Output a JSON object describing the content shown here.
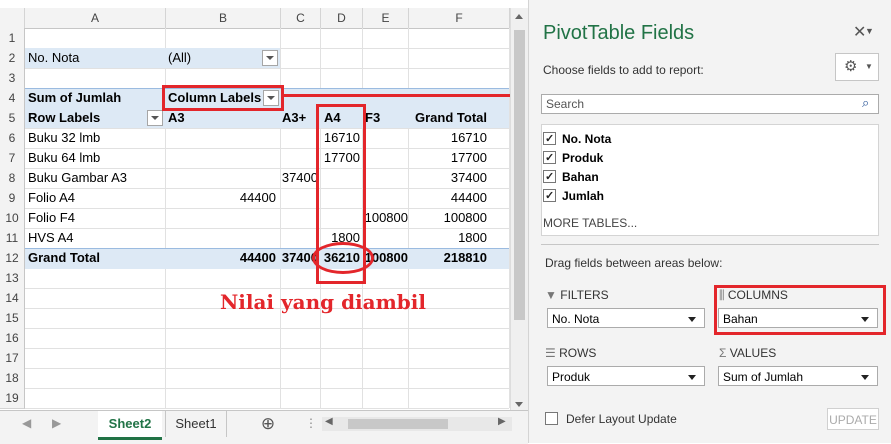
{
  "sheet": {
    "columns": [
      "A",
      "B",
      "C",
      "D",
      "E",
      "F"
    ],
    "rows": [
      "1",
      "2",
      "3",
      "4",
      "5",
      "6",
      "7",
      "8",
      "9",
      "10",
      "11",
      "12",
      "13",
      "14",
      "15",
      "16",
      "17",
      "18",
      "19"
    ],
    "filter_label": "No. Nota",
    "filter_value": "(All)",
    "sum_label": "Sum of Jumlah",
    "column_labels": "Column Labels",
    "row_labels": "Row Labels",
    "col_a3": "A3",
    "col_a3plus": "A3+",
    "col_a4": "A4",
    "col_f3": "F3",
    "grand_total_header": "Grand Total",
    "data_rows": [
      {
        "label": "Buku 32 lmb",
        "a3": "",
        "a3plus": "",
        "a4": "16710",
        "f3": "",
        "total": "16710"
      },
      {
        "label": "Buku 64 lmb",
        "a3": "",
        "a3plus": "",
        "a4": "17700",
        "f3": "",
        "total": "17700"
      },
      {
        "label": "Buku Gambar A3",
        "a3": "",
        "a3plus": "37400",
        "a4": "",
        "f3": "",
        "total": "37400"
      },
      {
        "label": "Folio A4",
        "a3": "44400",
        "a3plus": "",
        "a4": "",
        "f3": "",
        "total": "44400"
      },
      {
        "label": "Folio F4",
        "a3": "",
        "a3plus": "",
        "a4": "",
        "f3": "100800",
        "total": "100800"
      },
      {
        "label": "HVS A4",
        "a3": "",
        "a3plus": "",
        "a4": "1800",
        "f3": "",
        "total": "1800"
      }
    ],
    "grand_total_row": {
      "label": "Grand Total",
      "a3": "44400",
      "a3plus": "37400",
      "a4": "36210",
      "f3": "100800",
      "total": "218810"
    },
    "annotation": "Nilai yang diambil"
  },
  "tabs": {
    "active": "Sheet2",
    "other": "Sheet1",
    "add": "⊕"
  },
  "pane": {
    "title": "PivotTable Fields",
    "subtitle": "Choose fields to add to report:",
    "search_placeholder": "Search",
    "fields": [
      "No. Nota",
      "Produk",
      "Bahan",
      "Jumlah"
    ],
    "more_tables": "MORE TABLES...",
    "drag_hint": "Drag fields between areas below:",
    "filters_title": "FILTERS",
    "filters_value": "No. Nota",
    "columns_title": "COLUMNS",
    "columns_value": "Bahan",
    "rows_title": "ROWS",
    "rows_value": "Produk",
    "values_title": "VALUES",
    "values_value": "Sum of Jumlah",
    "defer_label": "Defer Layout Update",
    "update_label": "UPDATE"
  },
  "colors": {
    "accent_red": "#e3262b",
    "pivot_header": "#dde9f5",
    "green_tab": "#217346"
  }
}
